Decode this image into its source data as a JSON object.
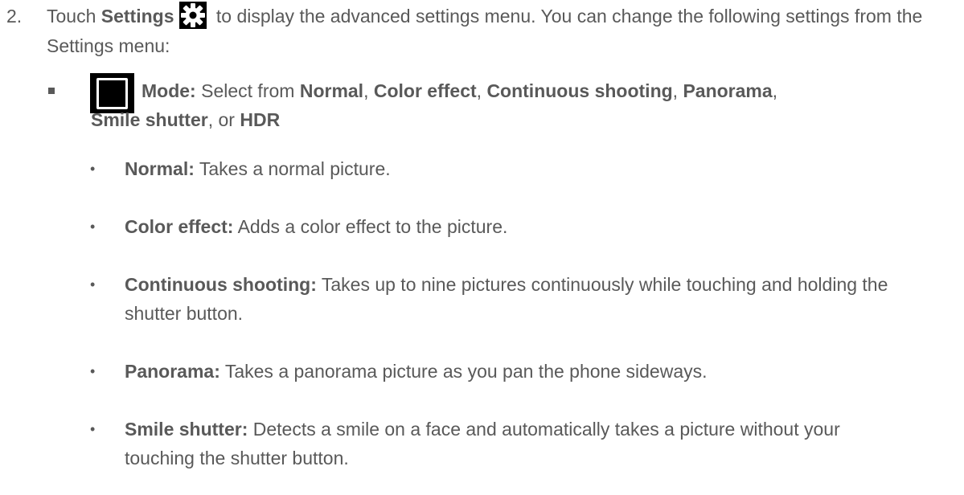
{
  "step": {
    "number": "2.",
    "part1": "Touch ",
    "settings_label": "Settings",
    "part2": " to display the advanced settings menu. You can change the following settings from the Settings menu:",
    "icon": "gear-icon"
  },
  "mode_item": {
    "icon": "square-frame-icon",
    "label": "Mode:",
    "intro": " Select from ",
    "opt_normal": "Normal",
    "sep1": ", ",
    "opt_color": "Color effect",
    "sep2": ", ",
    "opt_continuous": "Continuous shooting",
    "sep3": ", ",
    "opt_panorama": "Panorama",
    "sep4": ",",
    "opt_smile": "Smile shutter",
    "sep5": ", or ",
    "opt_hdr": "HDR"
  },
  "sub_items": [
    {
      "bullet": "•",
      "term": "Normal:",
      "desc": " Takes a normal picture."
    },
    {
      "bullet": "•",
      "term": "Color effect:",
      "desc": " Adds a color effect to the picture."
    },
    {
      "bullet": "•",
      "term": "Continuous shooting:",
      "desc": " Takes up to nine pictures continuously while touching and holding the shutter button."
    },
    {
      "bullet": "•",
      "term": "Panorama:",
      "desc": " Takes a panorama picture as you pan the phone sideways."
    },
    {
      "bullet": "•",
      "term": "Smile shutter:",
      "desc": " Detects a smile on a face and automatically takes a picture without your touching the shutter button."
    }
  ]
}
